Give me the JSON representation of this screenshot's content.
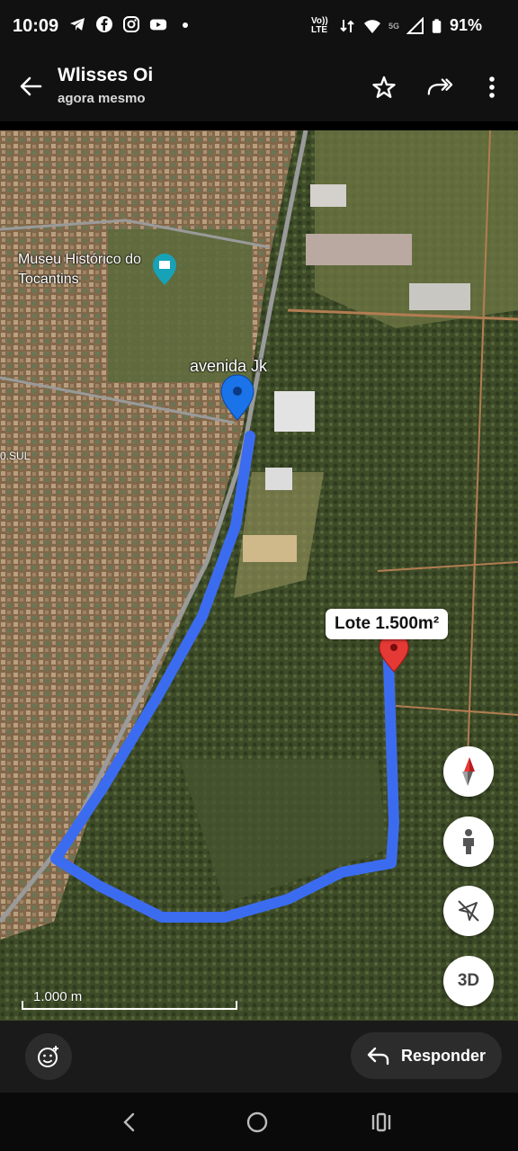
{
  "status_bar": {
    "time": "10:09",
    "network": "Vo)) LTE",
    "signal_label": "5G",
    "battery": "91%"
  },
  "app_bar": {
    "title": "Wlisses Oi",
    "subtitle": "agora mesmo"
  },
  "map": {
    "labels": {
      "museum": "Museu Histórico do Tocantins",
      "avenida": "avenida Jk",
      "lote": "Lote 1.500m²",
      "sul": "0.SUL"
    },
    "scale": "1.000 m",
    "three_d": "3D"
  },
  "bottom_bar": {
    "reply_label": "Responder"
  },
  "colors": {
    "route": "#3b6cf0",
    "pin_blue": "#1a73e8",
    "pin_red": "#e53935"
  }
}
